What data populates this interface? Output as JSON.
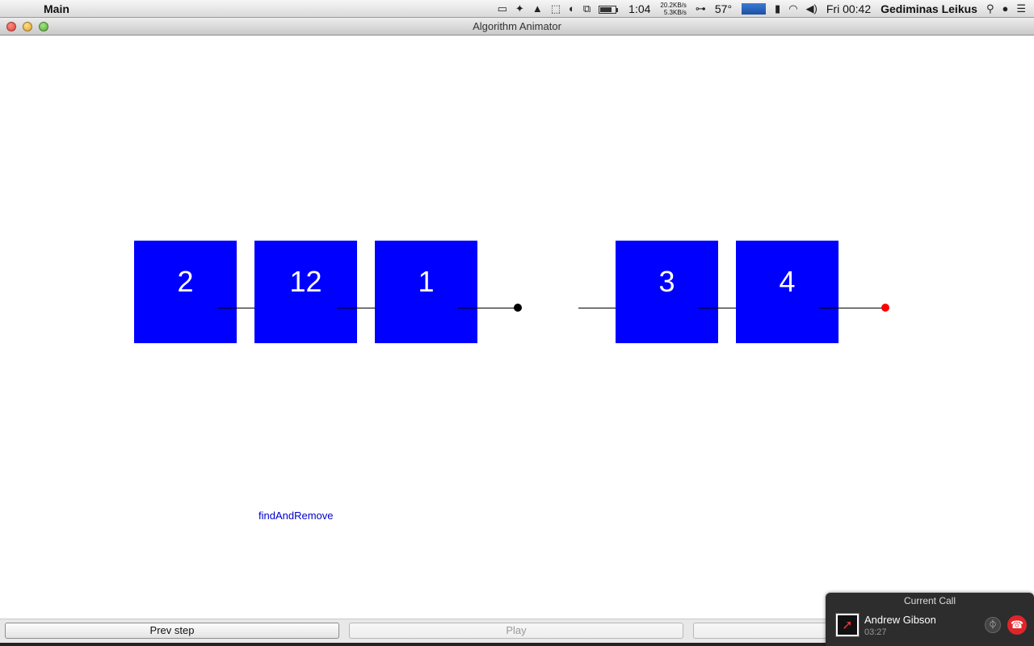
{
  "menubar": {
    "app_name": "Main",
    "clock": "1:04",
    "net_down": "20.2KB/s",
    "net_up": "5.3KB/s",
    "temperature": "57°",
    "datetime": "Fri 00:42",
    "user": "Gediminas Leikus",
    "battery_level": 0.75
  },
  "window": {
    "title": "Algorithm Animator"
  },
  "nodes": [
    {
      "value": "2",
      "color": "#0000ff"
    },
    {
      "value": "12",
      "color": "#0000ff"
    },
    {
      "value": "1",
      "color": "#0000ff"
    },
    {
      "value": "3",
      "color": "#0000ff"
    },
    {
      "value": "4",
      "color": "#0000ff"
    }
  ],
  "null_pointer_color": "#ff0000",
  "status_label": "findAndRemove",
  "controls": {
    "prev_step": "Prev step",
    "play": "Play"
  },
  "call": {
    "header": "Current Call",
    "name": "Andrew Gibson",
    "duration": "03:27"
  }
}
